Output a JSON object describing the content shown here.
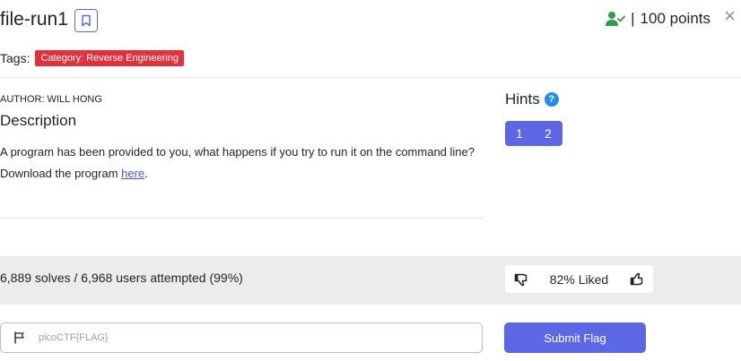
{
  "header": {
    "title": "file-run1",
    "points_separator": "|",
    "points": "100 points",
    "close_symbol": "×"
  },
  "tags": {
    "label": "Tags:",
    "items": [
      "Category: Reverse Engineering"
    ]
  },
  "description": {
    "author": "AUTHOR: WILL HONG",
    "heading": "Description",
    "body": "A program has been provided to you, what happens if you try to run it on the command line?",
    "download_prefix": "Download the program ",
    "download_link": "here",
    "download_suffix": "."
  },
  "hints": {
    "title": "Hints",
    "help_symbol": "?",
    "buttons": [
      "1",
      "2"
    ]
  },
  "stats": {
    "text": "6,889 solves / 6,968 users attempted (99%)",
    "liked": "82% Liked"
  },
  "flag_form": {
    "placeholder": "picoCTF{FLAG}",
    "value": "",
    "submit_label": "Submit Flag"
  },
  "colors": {
    "accent": "#5b67e4",
    "tag_red": "#e0313d",
    "user_icon_green": "#2e9e4a",
    "help_blue": "#1e90e6",
    "band_gray": "#ececec"
  },
  "icons": {
    "bookmark": "bookmark-icon",
    "user_check": "user-check-icon",
    "close": "close-icon",
    "help": "help-icon",
    "thumbs_down": "thumbs-down-icon",
    "thumbs_up": "thumbs-up-icon",
    "flag": "flag-icon"
  }
}
